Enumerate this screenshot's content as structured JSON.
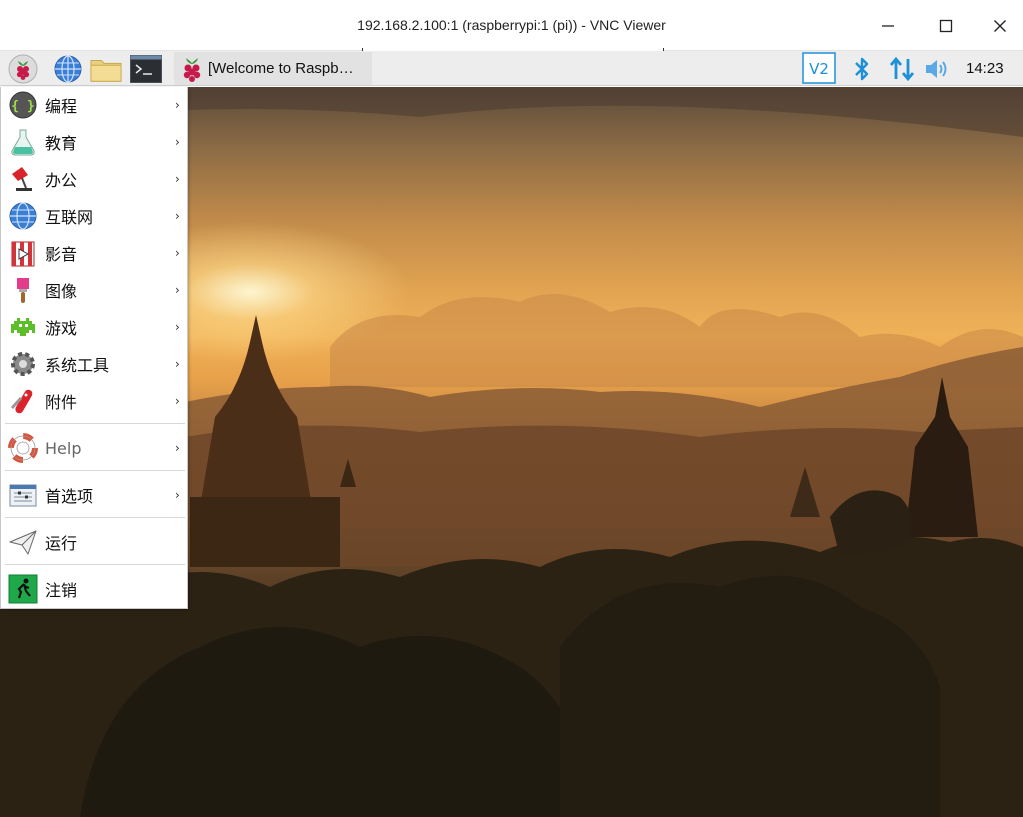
{
  "window": {
    "title": "192.168.2.100:1 (raspberrypi:1 (pi)) - VNC Viewer"
  },
  "taskbar": {
    "launchers": [
      "raspberry-menu-icon",
      "web-browser-icon",
      "file-manager-icon",
      "terminal-icon"
    ],
    "task_label": "[Welcome to Raspb…",
    "clock": "14:23",
    "tray": [
      "vnc-icon",
      "bluetooth-icon",
      "network-icon",
      "volume-icon"
    ]
  },
  "menu": {
    "items": [
      {
        "label": "编程",
        "icon": "programming-icon",
        "submenu": true
      },
      {
        "label": "教育",
        "icon": "education-icon",
        "submenu": true
      },
      {
        "label": "办公",
        "icon": "office-icon",
        "submenu": true
      },
      {
        "label": "互联网",
        "icon": "internet-icon",
        "submenu": true
      },
      {
        "label": "影音",
        "icon": "multimedia-icon",
        "submenu": true
      },
      {
        "label": "图像",
        "icon": "graphics-icon",
        "submenu": true
      },
      {
        "label": "游戏",
        "icon": "games-icon",
        "submenu": true
      },
      {
        "label": "系统工具",
        "icon": "system-tools-icon",
        "submenu": true
      },
      {
        "label": "附件",
        "icon": "accessories-icon",
        "submenu": true
      },
      {
        "label": "Help",
        "icon": "help-icon",
        "submenu": true
      },
      {
        "label": "首选项",
        "icon": "preferences-icon",
        "submenu": true
      },
      {
        "label": "运行",
        "icon": "run-icon",
        "submenu": false
      },
      {
        "label": "注销",
        "icon": "logout-icon",
        "submenu": false
      }
    ]
  },
  "colors": {
    "raspberry": "#c51a4a",
    "accent": "#1e90d8",
    "menu_bg": "#ffffff"
  }
}
